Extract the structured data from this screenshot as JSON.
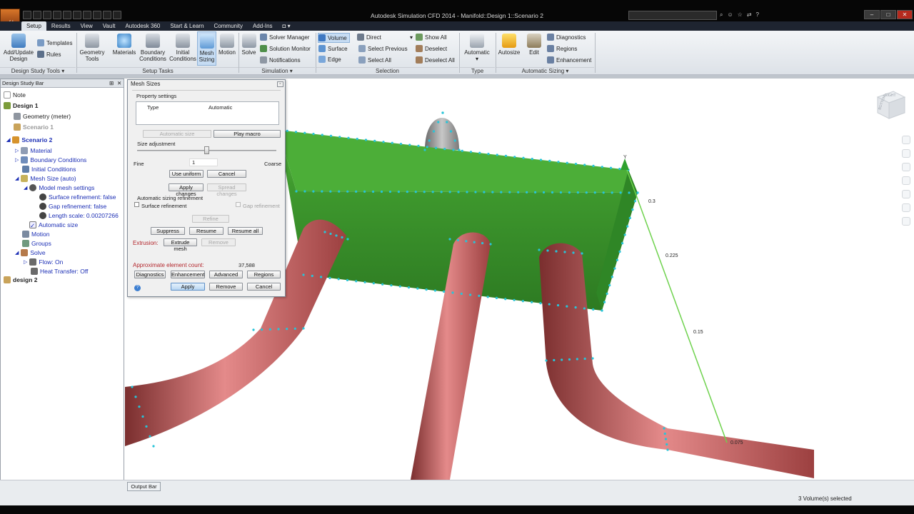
{
  "app": {
    "title": "Autodesk Simulation CFD 2014 - Manifold::Design 1::Scenario 2",
    "icon_label": "cfd"
  },
  "title_icons": [
    "binoculars-icon",
    "user-icon",
    "star-icon",
    "exchange-icon",
    "help-icon"
  ],
  "tabs": [
    {
      "label": "Setup",
      "active": true
    },
    {
      "label": "Results"
    },
    {
      "label": "View"
    },
    {
      "label": "Vault"
    },
    {
      "label": "Autodesk 360"
    },
    {
      "label": "Start & Learn"
    },
    {
      "label": "Community"
    },
    {
      "label": "Add-Ins"
    }
  ],
  "ribbon": {
    "design_study_tools": {
      "label": "Design Study Tools",
      "add_update": "Add/Update Design",
      "templates": "Templates",
      "rules": "Rules"
    },
    "setup_tasks": {
      "label": "Setup Tasks",
      "geometry_tools": "Geometry Tools",
      "materials": "Materials",
      "boundary_conditions": "Boundary Conditions",
      "initial_conditions": "Initial Conditions",
      "mesh_sizing": "Mesh Sizing",
      "motion": "Motion"
    },
    "simulation": {
      "label": "Simulation",
      "solve": "Solve",
      "solver_manager": "Solver Manager",
      "solution_monitor": "Solution Monitor",
      "notifications": "Notifications"
    },
    "selection": {
      "label": "Selection",
      "volume": "Volume",
      "surface": "Surface",
      "edge": "Edge",
      "direct": "Direct",
      "select_previous": "Select Previous",
      "select_all": "Select All",
      "show_all": "Show All",
      "deselect": "Deselect",
      "deselect_all": "Deselect All"
    },
    "type": {
      "label": "Type",
      "automatic": "Automatic"
    },
    "automatic_sizing": {
      "label": "Automatic Sizing",
      "autosize": "Autosize",
      "edit": "Edit",
      "diagnostics": "Diagnostics",
      "regions": "Regions",
      "enhancement": "Enhancement"
    }
  },
  "design_study_bar": {
    "title": "Design Study Bar",
    "items": [
      {
        "label": "Note"
      },
      {
        "label": "Design 1"
      },
      {
        "label": "Geometry (meter)"
      },
      {
        "label": "Scenario 1"
      },
      {
        "label": "Scenario 2"
      },
      {
        "label": "Material"
      },
      {
        "label": "Boundary Conditions"
      },
      {
        "label": "Initial Conditions"
      },
      {
        "label": "Mesh Size (auto)"
      },
      {
        "label": "Model mesh settings"
      },
      {
        "label": "Surface refinement: false"
      },
      {
        "label": "Gap refinement: false"
      },
      {
        "label": "Length scale: 0.00207266"
      },
      {
        "label": "Automatic size"
      },
      {
        "label": "Motion"
      },
      {
        "label": "Groups"
      },
      {
        "label": "Solve"
      },
      {
        "label": "Flow: On"
      },
      {
        "label": "Heat Transfer: Off"
      },
      {
        "label": "design 2"
      }
    ]
  },
  "mesh_dialog": {
    "title": "Mesh Sizes",
    "property_settings": "Property settings",
    "table": {
      "col_type": "Type",
      "col_value": "Automatic"
    },
    "automatic_size_btn": "Automatic size",
    "play_macro_btn": "Play macro",
    "size_adjustment": "Size adjustment",
    "fine": "Fine",
    "coarse": "Coarse",
    "size_value": "1",
    "use_uniform": "Use uniform",
    "cancel_small": "Cancel",
    "apply_changes": "Apply changes",
    "spread_changes": "Spread changes",
    "auto_refine_label": "Automatic sizing refinement",
    "surface_refinement": "Surface refinement",
    "gap_refinement": "Gap refinement",
    "refine": "Refine",
    "suppress": "Suppress",
    "resume": "Resume",
    "resume_all": "Resume all",
    "extrusion_label": "Extrusion:",
    "extrude_mesh": "Extrude mesh",
    "remove_small": "Remove",
    "approx_label": "Approximate element count:",
    "approx_value": "37,588",
    "diagnostics": "Diagnostics",
    "enhancement": "Enhancement",
    "advanced": "Advanced",
    "regions": "Regions",
    "apply": "Apply",
    "remove": "Remove",
    "cancel": "Cancel"
  },
  "viewport": {
    "ruler_labels": [
      "0.3",
      "0.225",
      "0.15",
      "0.075"
    ],
    "axis_label": "Y",
    "viewcube": {
      "top": "RIGHT",
      "side": "BOTTOM"
    },
    "colors": {
      "manifold": "#3e9a2e",
      "pipe": "#d06a6a",
      "stub": "#9a9a9a",
      "dots": "#27c4d8",
      "ruler": "#6fd24e"
    }
  },
  "output_bar": "Output Bar",
  "status": "3 Volume(s) selected"
}
